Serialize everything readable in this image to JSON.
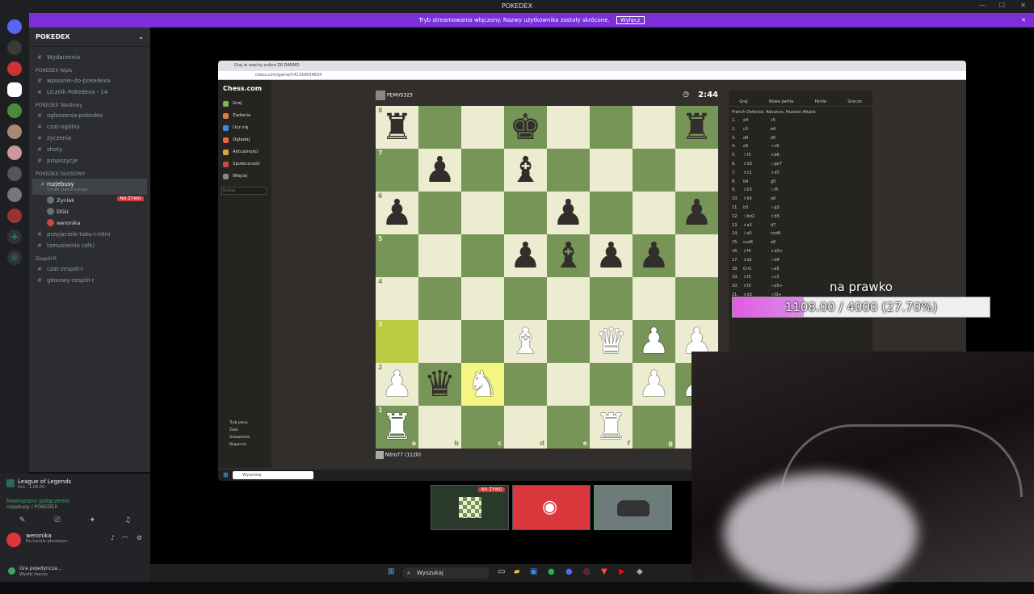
{
  "app": {
    "title": "POKEDEX"
  },
  "banner": {
    "text": "Tryb streamowania włączony. Nazwy użytkownika zostały skrócone.",
    "button": "Wyłącz"
  },
  "server": {
    "name": "POKEDEX",
    "events": "Wydarzenia",
    "categories": [
      {
        "name": "POKEDEX Wpis",
        "channels": [
          "wpisanie-do-pokedexa",
          "Licznik Pokedexa - 14"
        ]
      },
      {
        "name": "POKEDEX Tekstowy",
        "channels": [
          "ogloszenia-pokedex",
          "czat-ogólny",
          "życzenia",
          "shoty",
          "propozycje"
        ]
      }
    ],
    "voice_category": "POKEDEX GŁOSOWY",
    "active_channel": "rozjebusy",
    "active_status": "Ustaw status kanału",
    "voice_users": [
      {
        "name": "Zynlak",
        "live": "NA ŻYWO"
      },
      {
        "name": "DGU",
        "live": ""
      },
      {
        "name": "weronika",
        "live": ""
      }
    ],
    "more_voice": [
      "przyjaciele-taku-i-nitro",
      "lamusiarnia (afk)"
    ],
    "team_category": "Zespół R",
    "team_channels": [
      "czat-zespół-r",
      "głosowy-zespół-r"
    ]
  },
  "activity": {
    "game": "League of Legends",
    "game_sub": "Gra - 1:06:00",
    "connection": "Nawiązano połączenie",
    "connection_sub": "rozjebusy / POKEDEX"
  },
  "user": {
    "name": "weronika",
    "status": "Na kanale głosowym"
  },
  "notify": {
    "title": "Gra pojedyncza...",
    "sub": "Wyniki meczu"
  },
  "browser": {
    "tab": "Graj w szachy online ZA DARMO",
    "url": "chess.com/game/141339634834"
  },
  "chess_nav": {
    "logo": "Chess.com",
    "items": [
      "Graj",
      "Zadania",
      "Ucz się",
      "Oglądaj",
      "Aktualności",
      "Społeczność",
      "Więcej"
    ],
    "search_placeholder": "Szukaj",
    "bottom": [
      "Tryb jasny",
      "Zwiń",
      "Ustawienia",
      "Wsparcie"
    ]
  },
  "game": {
    "top_player": "PEMVS323",
    "bottom_player": "Nitro77 (1120)",
    "clock": "2:44",
    "ranks": [
      "8",
      "7",
      "6",
      "5",
      "4",
      "3",
      "2",
      "1"
    ],
    "files": [
      "a",
      "b",
      "c",
      "d",
      "e",
      "f",
      "g"
    ],
    "board": [
      [
        "bR",
        "",
        "",
        "bK",
        "",
        "",
        "",
        "bR"
      ],
      [
        "",
        "bP",
        "",
        "bB",
        "",
        "",
        "",
        ""
      ],
      [
        "bP",
        "",
        "",
        "",
        "bP",
        "",
        "",
        "bP"
      ],
      [
        "",
        "",
        "",
        "bP",
        "bB",
        "bP",
        "bP",
        ""
      ],
      [
        "",
        "",
        "",
        "",
        "",
        "",
        "",
        ""
      ],
      [
        "",
        "",
        "",
        "wB",
        "",
        "wQ",
        "wP",
        "wP"
      ],
      [
        "wP",
        "bQ",
        "wN",
        "",
        "",
        "",
        "wP",
        "wP"
      ],
      [
        "wR",
        "",
        "",
        "",
        "",
        "wR",
        "",
        ""
      ]
    ],
    "opening": "French Defense: Advance, Paulsen Attack",
    "tabs": [
      "Graj",
      "Nowa partia",
      "Partie",
      "Gracze"
    ],
    "moves": [
      [
        "e4",
        "c5"
      ],
      [
        "c3",
        "e6"
      ],
      [
        "d4",
        "d5"
      ],
      [
        "e5",
        "♘c6"
      ],
      [
        "♘f3",
        "♕b6"
      ],
      [
        "♗d3",
        "♘ge7"
      ],
      [
        "♗c2",
        "♗d7"
      ],
      [
        "b4",
        "g5"
      ],
      [
        "♗b3",
        "♘f5"
      ],
      [
        "♗b5",
        "a6"
      ],
      [
        "b3",
        "♘g3"
      ],
      [
        "♘bd2",
        "♗b5"
      ],
      [
        "♗a3",
        "d7"
      ],
      [
        "♘e5",
        "cxd4"
      ],
      [
        "cxd4",
        "e6"
      ],
      [
        "♗f4",
        "♗d3+"
      ],
      [
        "♗d1",
        "♘d4"
      ],
      [
        "O-O",
        "♘e5"
      ],
      [
        "♗f3",
        "♘c3"
      ],
      [
        "♗f3",
        "♘e5+"
      ],
      [
        "♗d3",
        "♘f3+"
      ],
      [
        "♗f2",
        "♗d6"
      ],
      [
        "♗d4+",
        "♗d6"
      ]
    ]
  },
  "overlay": {
    "label": "na prawko",
    "progress_text": "1108.00 / 4000 (27.70%)",
    "progress": 0.277
  },
  "stream_thumbs": {
    "live": "NA ŻYWO"
  },
  "taskbar": {
    "search": "Wyszukaj",
    "inner_search": "Wyszukaj"
  },
  "colors": {
    "accent": "#7b2fd8",
    "discord": "#5865f2",
    "live": "#da373c",
    "board_light": "#ebecd0",
    "board_dark": "#779556"
  }
}
